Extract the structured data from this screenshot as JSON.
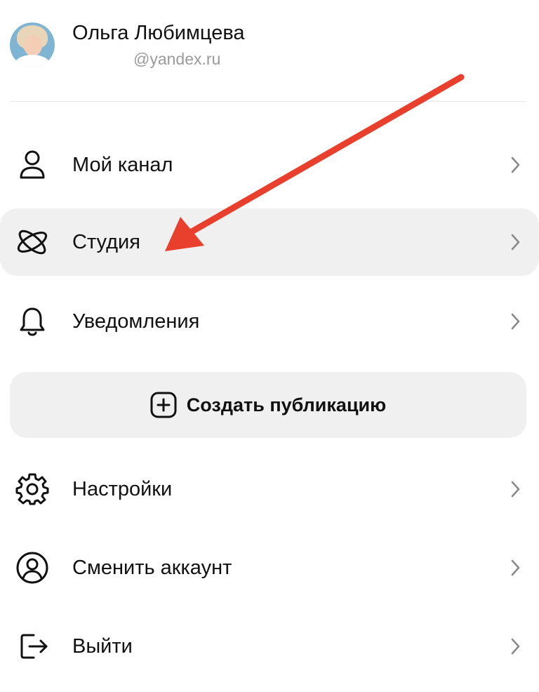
{
  "profile": {
    "name": "Ольга Любимцева",
    "email": "@yandex.ru"
  },
  "menu": {
    "items": [
      {
        "id": "my-channel",
        "label": "Мой канал",
        "icon": "person-icon"
      },
      {
        "id": "studio",
        "label": "Студия",
        "icon": "atom-icon",
        "active": true
      },
      {
        "id": "notifications",
        "label": "Уведомления",
        "icon": "bell-icon"
      }
    ],
    "create_button": {
      "label": "Создать публикацию",
      "icon": "plus-square-icon"
    },
    "bottom_items": [
      {
        "id": "settings",
        "label": "Настройки",
        "icon": "gear-icon"
      },
      {
        "id": "switch-account",
        "label": "Сменить аккаунт",
        "icon": "account-circle-icon"
      },
      {
        "id": "logout",
        "label": "Выйти",
        "icon": "logout-icon"
      }
    ]
  },
  "annotation": {
    "arrow_color": "#e8402d",
    "icon": "red-arrow-icon"
  },
  "colors": {
    "active_background": "#f0f0f0",
    "secondary_text": "#9a9a9a",
    "text": "#111111"
  }
}
